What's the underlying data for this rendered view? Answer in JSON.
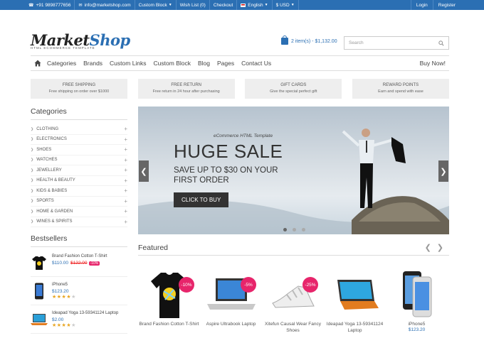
{
  "topbar": {
    "phone": "+91 9898777656",
    "email": "info@marketshop.com",
    "custom_block": "Custom Block",
    "wishlist": "Wish List (0)",
    "checkout": "Checkout",
    "language": "English",
    "currency": "$ USD",
    "login": "Login",
    "register": "Register"
  },
  "header": {
    "logo_market": "Market",
    "logo_shop": "Shop",
    "tagline": "HTML ECOMMERCE TEMPLATE",
    "cart": "2 item(s) - $1,132.00",
    "search_placeholder": "Search"
  },
  "nav": {
    "items": [
      "Categories",
      "Brands",
      "Custom Links",
      "Custom Block",
      "Blog",
      "Pages",
      "Contact Us"
    ],
    "buy_now": "Buy Now!"
  },
  "features": [
    {
      "title": "FREE SHIPPING",
      "text": "Free shipping on order over $1000"
    },
    {
      "title": "FREE RETURN",
      "text": "Free return in 24 hour after purchasing"
    },
    {
      "title": "GIFT CARDS",
      "text": "Give the special perfect gift"
    },
    {
      "title": "REWARD POINTS",
      "text": "Earn and spend with ease"
    }
  ],
  "categories": {
    "title": "Categories",
    "items": [
      "CLOTHING",
      "ELECTRONICS",
      "SHOES",
      "WATCHES",
      "JEWELLERY",
      "HEALTH & BEAUTY",
      "KIDS & BABIES",
      "SPORTS",
      "HOME & GARDEN",
      "WINES & SPIRITS"
    ]
  },
  "bestsellers": {
    "title": "Bestsellers",
    "items": [
      {
        "name": "Brand Fashion Cotton T-Shirt",
        "price": "$110.00",
        "old_price": "$122.00",
        "badge": "-10%",
        "rating": null
      },
      {
        "name": "iPhone5",
        "price": "$123.20",
        "old_price": "",
        "badge": "",
        "rating": 4
      },
      {
        "name": "Ideapad Yoga 13-59341124 Laptop",
        "price": "$2.00",
        "old_price": "",
        "badge": "",
        "rating": 4
      }
    ]
  },
  "banner": {
    "subtitle": "eCommerce HTML Template",
    "headline": "HUGE SALE",
    "line": "SAVE UP TO $30 ON YOUR FIRST ORDER",
    "cta": "CLICK TO BUY",
    "slides": 3,
    "active_slide": 1
  },
  "featured": {
    "title": "Featured",
    "products": [
      {
        "name": "Brand Fashion Cotton T-Shirt",
        "badge": "-10%",
        "price": ""
      },
      {
        "name": "Aspire Ultrabook Laptop",
        "badge": "-5%",
        "price": ""
      },
      {
        "name": "Xitefun Causal Wear Fancy Shoes",
        "badge": "-25%",
        "price": ""
      },
      {
        "name": "Ideapad Yoga 13-59341124 Laptop",
        "badge": "",
        "price": ""
      },
      {
        "name": "iPhone5",
        "badge": "",
        "price": "$123.20"
      }
    ]
  },
  "colors": {
    "accent": "#2b6fb3",
    "sale": "#e7256b",
    "star": "#e8a520"
  }
}
